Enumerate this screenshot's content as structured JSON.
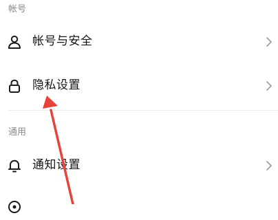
{
  "sections": [
    {
      "header": "帐号",
      "items": [
        {
          "label": "帐号与安全",
          "icon": "person-icon"
        },
        {
          "label": "隐私设置",
          "icon": "lock-icon"
        }
      ]
    },
    {
      "header": "通用",
      "items": [
        {
          "label": "通知设置",
          "icon": "bell-icon"
        },
        {
          "label": "",
          "icon": "partial-icon"
        }
      ]
    }
  ],
  "colors": {
    "section_header": "#8a8a8a",
    "label": "#161616",
    "chevron": "#9b9b9b",
    "annotation_arrow": "#e8433a",
    "divider": "#ececec"
  }
}
